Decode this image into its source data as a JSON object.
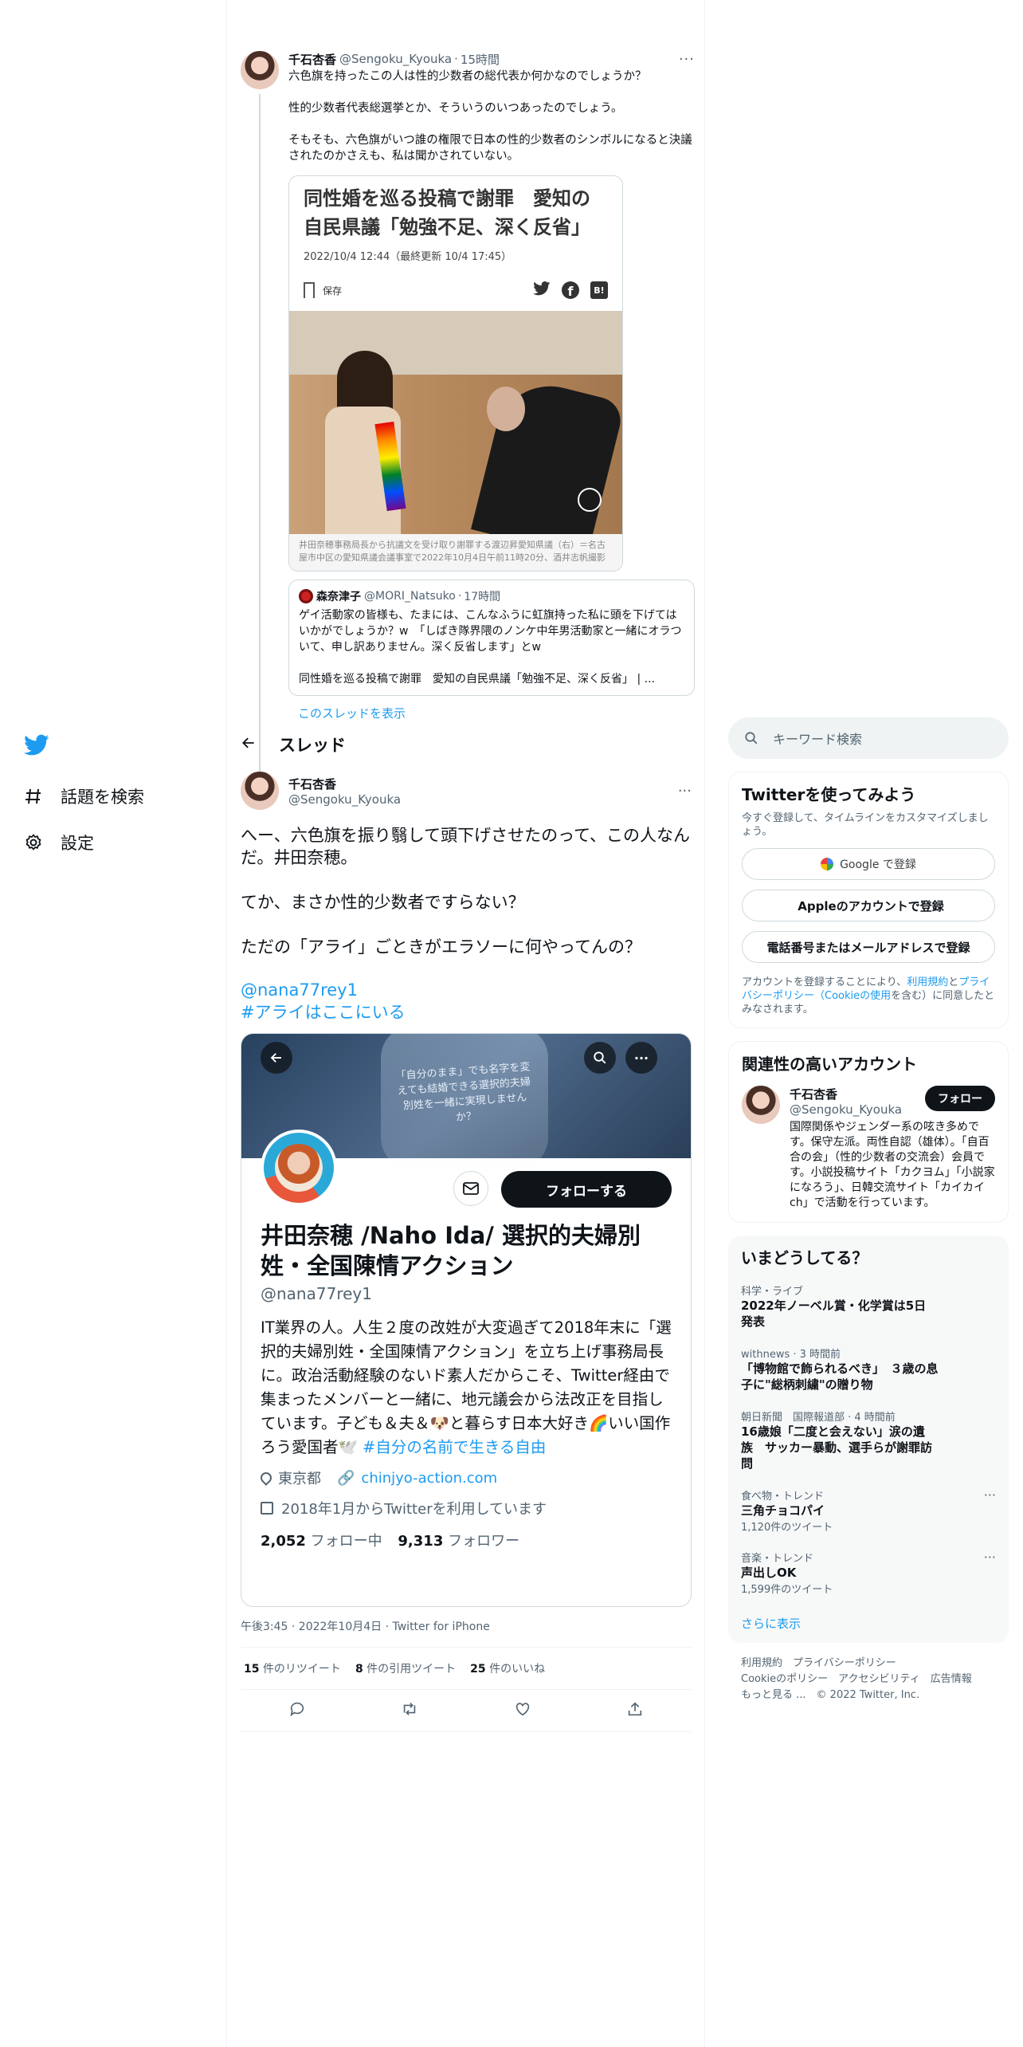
{
  "nav": {
    "explore": "話題を検索",
    "settings": "設定"
  },
  "parent_tweet": {
    "name": "千石杏香",
    "handle": "@Sengoku_Kyouka",
    "time": "15時間",
    "text": "六色旗を持ったこの人は性的少数者の総代表か何かなのでしょうか？\n\n性的少数者代表総選挙とか、そういうのいつあったのでしょう。\n\nそもそも、六色旗がいつ誰の権限で日本の性的少数者のシンボルになると決議されたのかさえも、私は聞かされていない。",
    "card": {
      "headline": "同性婚を巡る投稿で謝罪　愛知の自民県議「勉強不足、深く反省」",
      "date": "2022/10/4 12:44（最終更新 10/4 17:45）",
      "save": "保存",
      "caption": "井田奈穂事務局長から抗議文を受け取り謝罪する渡辺昇愛知県議（右）＝名古屋市中区の愛知県議会議事室で2022年10月4日午前11時20分、酒井志帆撮影",
      "hatena": "B!"
    },
    "quote": {
      "name": "森奈津子",
      "handle": "@MORI_Natsuko",
      "time": "17時間",
      "text": "ゲイ活動家の皆様も、たまには、こんなふうに虹旗持った私に頭を下げてはいかがでしょうか？w　「しばき隊界隈のノンケ中年男活動家と一緒にオラついて、申し訳ありません。深く反省します」とw\n\n同性婚を巡る投稿で謝罪　愛知の自民県議「勉強不足、深く反省」 | ..."
    },
    "show_thread": "このスレッドを表示"
  },
  "header": {
    "title": "スレッド"
  },
  "main_tweet": {
    "name": "千石杏香",
    "handle": "@Sengoku_Kyouka",
    "text": "へー、六色旗を振り翳して頭下げさせたのって、この人なんだ。井田奈穂。\n\nてか、まさか性的少数者ですらない？\n\nただの「アライ」ごときがエラソーに何やってんの？",
    "mention": "@nana77rey1",
    "hashtag": "#アライはここにいる",
    "profile": {
      "banner_text": "「自分のまま」でも名字を変えても結婚できる選択的夫婦別姓を一緒に実現しませんか？",
      "follow": "フォローする",
      "name": "井田奈穂 /Naho Ida/ 選択的夫婦別姓・全国陳情アクション",
      "handle": "@nana77rey1",
      "bio": "IT業界の人。人生２度の改姓が大変過ぎて2018年末に「選択的夫婦別姓・全国陳情アクション」を立ち上げ事務局長に。政治活動経験のないド素人だからこそ、Twitter経由で集まったメンバーと一緒に、地元議会から法改正を目指しています。子ども＆夫＆🐶と暮らす日本大好き🌈いい国作ろう愛国者🕊️",
      "bio_tag": "#自分の名前で生きる自由",
      "location": "東京都",
      "url": "chinjyo-action.com",
      "joined": "2018年1月からTwitterを利用しています",
      "following_count": "2,052",
      "following_label": "フォロー中",
      "followers_count": "9,313",
      "followers_label": "フォロワー"
    },
    "meta": "午後3:45 · 2022年10月4日 · Twitter for iPhone",
    "retweets_count": "15",
    "retweets_label": "件のリツイート",
    "quotes_count": "8",
    "quotes_label": "件の引用ツイート",
    "likes_count": "25",
    "likes_label": "件のいいね"
  },
  "right": {
    "search_placeholder": "キーワード検索",
    "signup": {
      "title": "Twitterを使ってみよう",
      "subtitle": "今すぐ登録して、タイムラインをカスタマイズしましょう。",
      "google": "Google で登録",
      "apple": "Appleのアカウントで登録",
      "phone": "電話番号またはメールアドレスで登録",
      "terms_a": "アカウントを登録することにより、",
      "terms_link1": "利用規約",
      "terms_b": "と",
      "terms_link2": "プライバシーポリシー（Cookieの使用",
      "terms_c": "を含む）に同意したとみなされます。"
    },
    "related": {
      "title": "関連性の高いアカウント",
      "name": "千石杏香",
      "handle": "@Sengoku_Kyouka",
      "follow": "フォロー",
      "bio": "国際関係やジェンダー系の呟き多めです。保守左派。両性自認（雄体）。「自百合の会」（性的少数者の交流会）会員です。小説投稿サイト「カクヨム」「小説家になろう」、日韓交流サイト「カイカイch」で活動を行っています。"
    },
    "trends": {
      "title": "いまどうしてる？",
      "items": [
        {
          "context": "科学・ライブ",
          "title": "2022年ノーベル賞・化学賞は5日発表"
        },
        {
          "context": "withnews · 3 時間前",
          "title": "「博物館で飾られるべき」　３歳の息子に\"総柄刺繍\"の贈り物"
        },
        {
          "context": "朝日新聞　国際報道部 · 4 時間前",
          "title": "16歳娘「二度と会えない」涙の遺族　サッカー暴動、選手らが謝罪訪問"
        },
        {
          "context": "食べ物・トレンド",
          "title": "三角チョコパイ",
          "count": "1,120件のツイート"
        },
        {
          "context": "音楽・トレンド",
          "title": "声出しOK",
          "count": "1,599件のツイート"
        }
      ],
      "more": "さらに表示"
    },
    "footer": {
      "l1a": "利用規約",
      "l1b": "プライバシーポリシー",
      "l2a": "Cookieのポリシー",
      "l2b": "アクセシビリティ",
      "l2c": "広告情報",
      "l3a": "もっと見る ...",
      "l3b": "© 2022 Twitter, Inc."
    }
  },
  "colors": {
    "accent": "#1d9bf0",
    "text": "#0f1419",
    "muted": "#536471"
  }
}
